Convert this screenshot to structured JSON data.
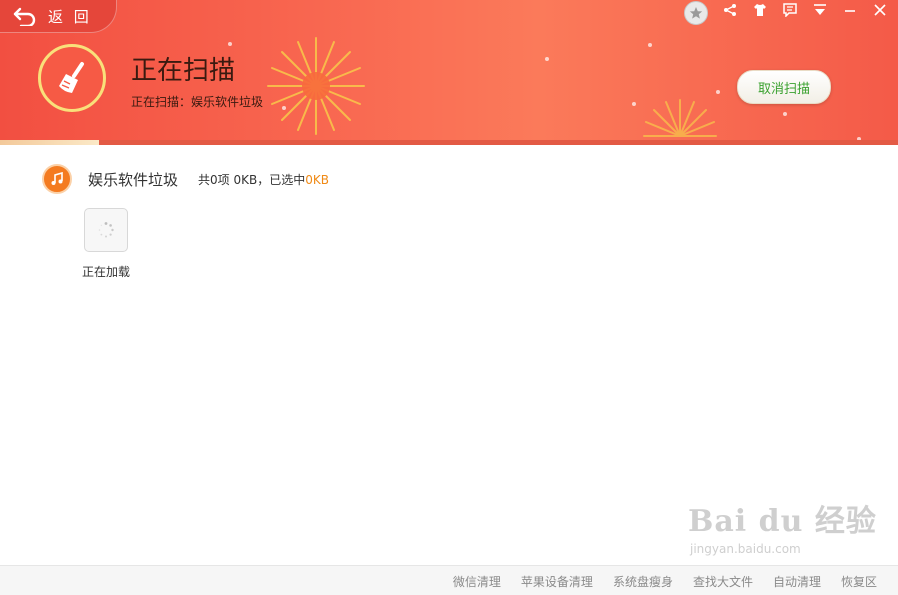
{
  "header": {
    "back_label": "返 回",
    "title": "正在扫描",
    "subtitle": "正在扫描：娱乐软件垃圾",
    "cancel_label": "取消扫描",
    "scan_progress": 0.11,
    "colors": {
      "header_start": "#f24f41",
      "header_end": "#f45a48",
      "accent_text": "#3aa12f"
    }
  },
  "window_controls": [
    "star-icon",
    "share-icon",
    "shirt-icon",
    "message-icon",
    "menu-icon",
    "minimize-icon",
    "close-icon"
  ],
  "category": {
    "icon": "music-icon",
    "name": "娱乐软件垃圾",
    "stats_prefix": "共0项 0KB，已选中",
    "stats_selected": "0KB",
    "selected_color": "#f08a16"
  },
  "loading": {
    "label": "正在加载",
    "icon": "spinner-icon"
  },
  "footer": {
    "links": [
      "微信清理",
      "苹果设备清理",
      "系统盘瘦身",
      "查找大文件",
      "自动清理",
      "恢复区"
    ]
  },
  "watermark": {
    "main": "Bai du 经验",
    "sub": "jingyan.baidu.com"
  }
}
